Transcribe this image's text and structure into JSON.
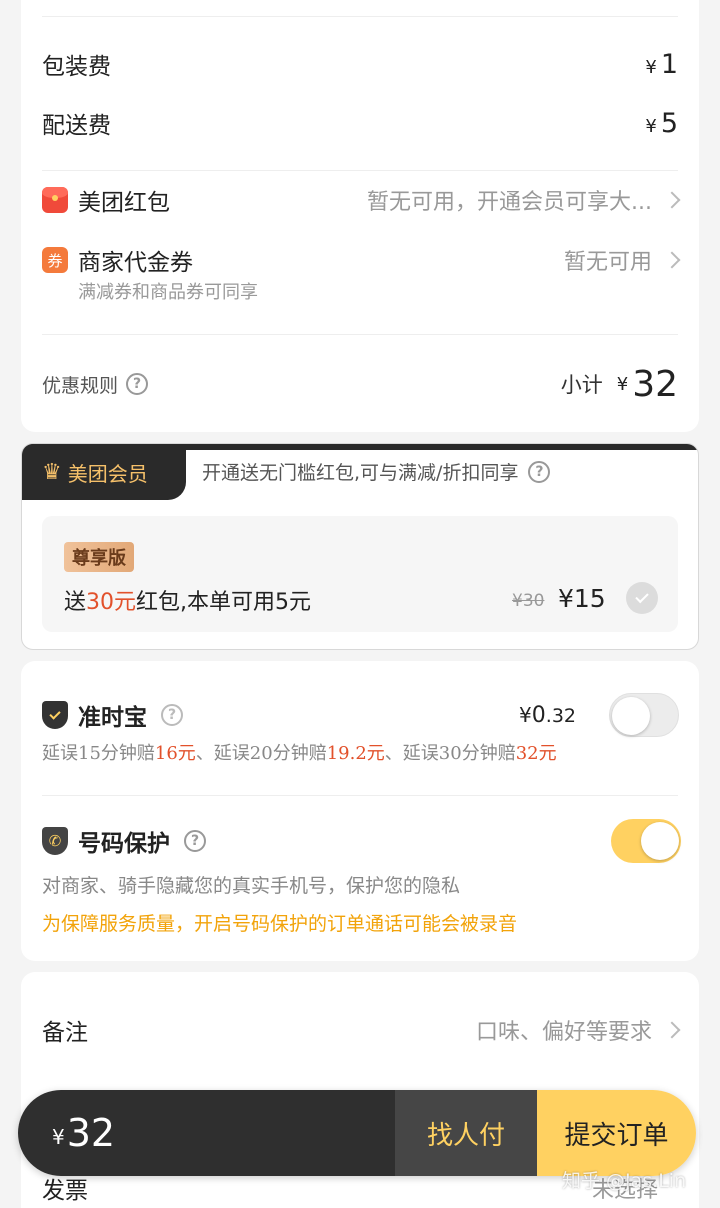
{
  "fees": {
    "packaging_label": "包装费",
    "packaging_value": "1",
    "delivery_label": "配送费",
    "delivery_value": "5",
    "currency": "¥"
  },
  "coupons": {
    "red_packet_label": "美团红包",
    "red_packet_status": "暂无可用，开通会员可享大...",
    "voucher_icon_text": "券",
    "voucher_label": "商家代金券",
    "voucher_status": "暂无可用",
    "voucher_note": "满减券和商品券可同享"
  },
  "subtotal": {
    "rules_label": "优惠规则",
    "subtotal_label": "小计",
    "value": "32"
  },
  "membership": {
    "badge": "美团会员",
    "headline": "开通送无门槛红包,可与满减/折扣同享",
    "tier": "尊享版",
    "offer_prefix": "送",
    "offer_highlight": "30元",
    "offer_suffix": "红包,本单可用5元",
    "original_price": "¥30",
    "price": "¥15",
    "selected": false
  },
  "insurance": {
    "title": "准时宝",
    "price_symbol": "¥",
    "price_int": "0",
    "price_dec": ".32",
    "desc_parts": [
      "延误15分钟赔",
      "16元",
      "、延误20分钟赔",
      "19.2元",
      "、延误30分钟赔",
      "32元"
    ],
    "enabled": false
  },
  "phone_protection": {
    "title": "号码保护",
    "desc": "对商家、骑手隐藏您的真实手机号，保护您的隐私",
    "notice": "为保障服务质量，开启号码保护的订单通话可能会被录音",
    "enabled": true
  },
  "remarks": {
    "label": "备注",
    "placeholder": "口味、偏好等要求"
  },
  "invoice": {
    "label": "发票",
    "value": "未选择"
  },
  "bottom_bar": {
    "currency": "¥",
    "total": "32",
    "pay_for_me": "找人付",
    "submit": "提交订单"
  },
  "watermark": "知乎 @Jas.Lin",
  "colors": {
    "accent_yellow": "#ffd161",
    "price_red": "#e2512b",
    "voucher_orange": "#f47a3c",
    "dark_bar": "#333333"
  }
}
